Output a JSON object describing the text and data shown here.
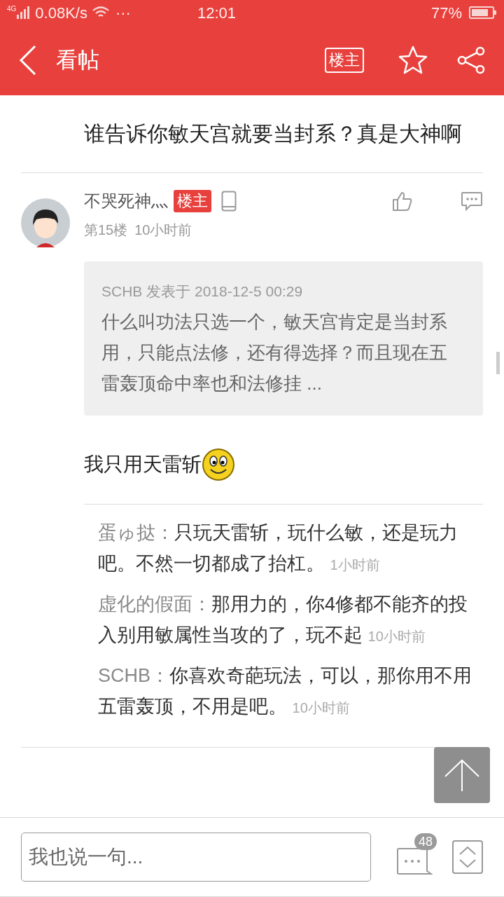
{
  "status_bar": {
    "network": "4G",
    "speed": "0.08K/s",
    "more": "···",
    "time": "12:01",
    "battery": "77%"
  },
  "header": {
    "title": "看帖",
    "op_badge": "楼主"
  },
  "post_text": "谁告诉你敏天宫就要当封系？真是大神啊",
  "floor": {
    "author": "不哭死神灬",
    "badge": "楼主",
    "floor": "第15楼",
    "time": "10小时前",
    "quote": {
      "meta": "SCHB 发表于 2018-12-5 00:29",
      "text": "什么叫功法只选一个，敏天宫肯定是当封系用，只能点法修，还有得选择？而且现在五雷轰顶命中率也和法修挂 ..."
    },
    "body": "我只用天雷斩",
    "replies": [
      {
        "author": "蛋ゅ挞：",
        "text": "只玩天雷斩，玩什么敏，还是玩力吧。不然一切都成了抬杠。",
        "time": "1小时前"
      },
      {
        "author": "虚化的假面：",
        "text": "那用力的，你4修都不能齐的投入别用敏属性当攻的了，玩不起",
        "time": "10小时前"
      },
      {
        "author": "SCHB：",
        "text": "你喜欢奇葩玩法，可以，那你用不用五雷轰顶，不用是吧。",
        "time": "10小时前"
      }
    ]
  },
  "composer": {
    "placeholder": "我也说一句...",
    "comment_count": "48"
  }
}
